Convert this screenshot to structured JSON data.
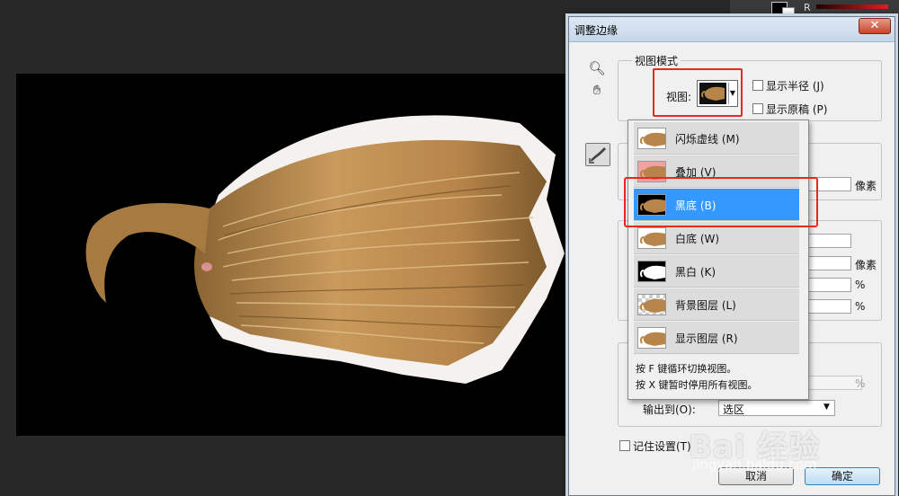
{
  "dialog": {
    "title": "调整边缘",
    "close_icon": "close-icon",
    "view_mode": {
      "group_title": "视图模式",
      "view_label": "视图:",
      "show_radius": "显示半径 (J)",
      "show_original": "显示原稿 (P)"
    },
    "fields": {
      "unit_pixels": "像素",
      "unit_percent": "%"
    },
    "output": {
      "label": "输出到(O):",
      "value": "选区"
    },
    "remember": "记住设置(T)",
    "cancel": "取消",
    "ok": "确定"
  },
  "workspace": {
    "channel_label": "R"
  },
  "view_dropdown": {
    "items": [
      {
        "label": "闪烁虚线 (M)",
        "bg": "#ffffff",
        "selected": false
      },
      {
        "label": "叠加 (V)",
        "bg": "#f2a0a0",
        "selected": false
      },
      {
        "label": "黑底 (B)",
        "bg": "#000000",
        "selected": true
      },
      {
        "label": "白底 (W)",
        "bg": "#ffffff",
        "selected": false
      },
      {
        "label": "黑白 (K)",
        "bg": "#000000",
        "selected": false
      },
      {
        "label": "背景图层 (L)",
        "bg": "checker",
        "selected": false
      },
      {
        "label": "显示图层 (R)",
        "bg": "#ffffff",
        "selected": false
      }
    ],
    "hint_1": "按 F 键循环切换视图。",
    "hint_2": "按 X 键暂时停用所有视图。"
  },
  "watermark": {
    "logo": "Bai 经验",
    "url": "jingyan.baidu.com"
  },
  "colors": {
    "highlight": "#e8281c",
    "selection": "#3399ff",
    "hair": "#b7854a"
  }
}
